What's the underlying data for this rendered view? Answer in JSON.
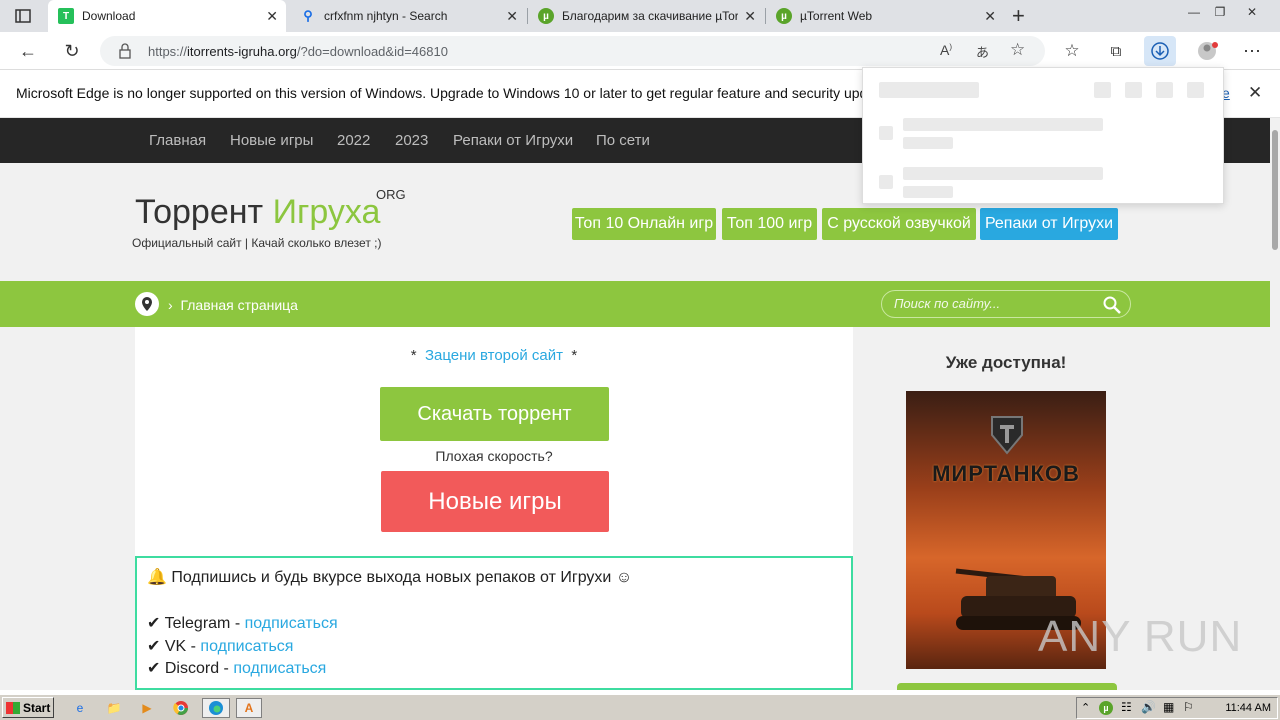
{
  "browser": {
    "tabs": [
      {
        "title": "Download",
        "favicon": "torrent-igruha-icon",
        "active": true
      },
      {
        "title": "crfxfnm njhtyn - Search",
        "favicon": "search-icon",
        "active": false
      },
      {
        "title": "Благодарим за скачивание µTorrent",
        "favicon": "utorrent-icon",
        "active": false
      },
      {
        "title": "µTorrent Web",
        "favicon": "utorrent-icon",
        "active": false
      }
    ],
    "url_prefix": "https://",
    "url_domain": "itorrents-igruha.org",
    "url_path": "/?do=download&id=46810",
    "infobar_text": "Microsoft Edge is no longer supported on this version of Windows. Upgrade to Windows 10 or later to get regular feature and security updates",
    "infobar_link": "e"
  },
  "site": {
    "nav": [
      "Главная",
      "Новые игры",
      "2022",
      "2023",
      "Репаки от Игрухи",
      "По сети"
    ],
    "brand_main": "Торрент",
    "brand_accent": "Игруха",
    "brand_org": "ORG",
    "brand_sub": "Официальный сайт | Качай сколько влезет ;)",
    "header_buttons": [
      "Топ 10 Онлайн игр",
      "Топ 100 игр",
      "С русской озвучкой",
      "Репаки от Игрухи"
    ],
    "breadcrumb": "Главная страница",
    "search_placeholder": "Поиск по сайту..."
  },
  "content": {
    "rate_prefix": "*",
    "rate_link": "Зацени второй сайт",
    "rate_suffix": "*",
    "download_button": "Скачать торрент",
    "slow_speed": "Плохая скорость?",
    "new_games_button": "Новые игры",
    "subscribe_title": "Подпишись и будь вкурсе выхода новых репаков от Игрухи",
    "subscribe_items": [
      {
        "name": "Telegram - ",
        "link": "подписаться"
      },
      {
        "name": "VK - ",
        "link": "подписаться"
      },
      {
        "name": "Discord - ",
        "link": "подписаться"
      }
    ]
  },
  "sidebar": {
    "title": "Уже доступна!",
    "poster_logo": "МИРТАНКОВ"
  },
  "watermark": "ANY RUN",
  "taskbar": {
    "start": "Start",
    "clock": "11:44 AM"
  },
  "colors": {
    "accent_green": "#8dc63f",
    "accent_blue": "#29a8e0",
    "accent_red": "#f25a5a",
    "nav_dark": "#262626"
  }
}
